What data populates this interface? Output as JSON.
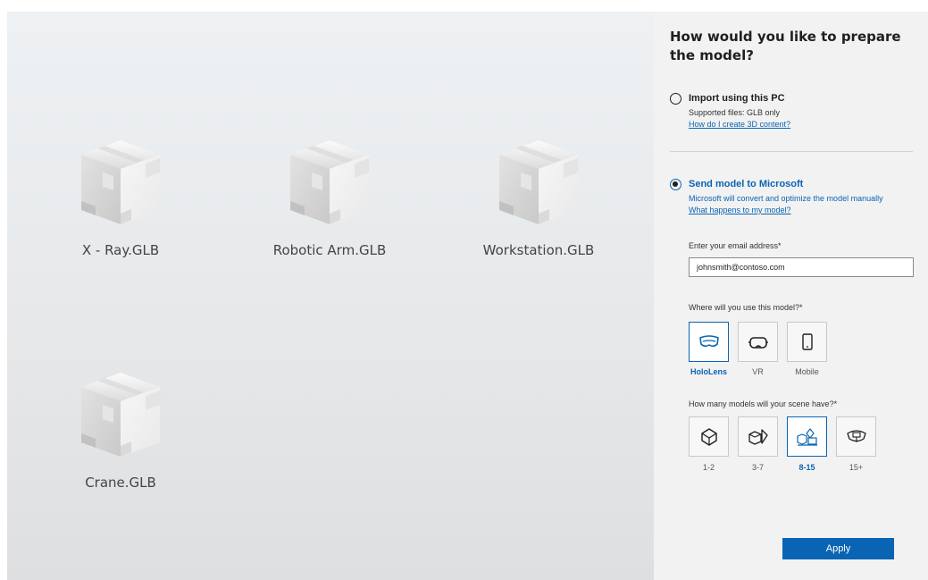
{
  "gallery": {
    "models": [
      {
        "name": "X - Ray.GLB"
      },
      {
        "name": "Robotic Arm.GLB"
      },
      {
        "name": "Workstation.GLB"
      },
      {
        "name": "Crane.GLB"
      }
    ]
  },
  "panel": {
    "title": "How would you like to prepare the model?",
    "import_option": {
      "title": "Import using this PC",
      "subtitle": "Supported files: GLB only",
      "link": "How do I create 3D content?",
      "selected": false
    },
    "send_option": {
      "title": "Send model to Microsoft",
      "subtitle": "Microsoft will convert and optimize the model manually",
      "link": "What happens to my model?",
      "selected": true
    },
    "email": {
      "label": "Enter your email address*",
      "value": "johnsmith@contoso.com"
    },
    "usage": {
      "label": "Where will you use this model?*",
      "options": [
        {
          "label": "HoloLens",
          "icon": "hololens-icon",
          "selected": true
        },
        {
          "label": "VR",
          "icon": "vr-headset-icon",
          "selected": false
        },
        {
          "label": "Mobile",
          "icon": "mobile-phone-icon",
          "selected": false
        }
      ]
    },
    "count": {
      "label": "How many models will your scene have?*",
      "options": [
        {
          "label": "1-2",
          "icon": "single-shape-icon",
          "selected": false
        },
        {
          "label": "3-7",
          "icon": "few-shapes-icon",
          "selected": false
        },
        {
          "label": "8-15",
          "icon": "many-shapes-icon",
          "selected": true
        },
        {
          "label": "15+",
          "icon": "scene-icon",
          "selected": false
        }
      ]
    },
    "apply_label": "Apply"
  },
  "colors": {
    "accent": "#0a64b4",
    "panel_bg": "#f2f2f2",
    "gallery_bg": "#e6e8ea"
  }
}
